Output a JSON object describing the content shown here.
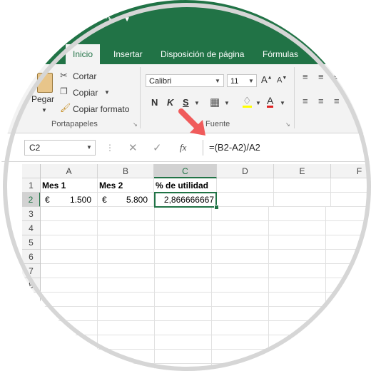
{
  "colors": {
    "accent": "#217346",
    "arrow": "#f05b5b"
  },
  "quick_access": {
    "icons": [
      "save-icon",
      "undo-icon",
      "redo-icon",
      "customize-icon"
    ]
  },
  "tabs": [
    {
      "label": "Inicio",
      "active": true
    },
    {
      "label": "Insertar"
    },
    {
      "label": "Disposición de página"
    },
    {
      "label": "Fórmulas"
    }
  ],
  "clipboard": {
    "paste": "Pegar",
    "cut": "Cortar",
    "copy": "Copiar",
    "format_painter": "Copiar formato",
    "group": "Portapapeles"
  },
  "font": {
    "name": "Calibri",
    "size": "11",
    "bold": "N",
    "italic": "K",
    "underline": "S",
    "group": "Fuente"
  },
  "formula_bar": {
    "name_box": "C2",
    "fx": "fx",
    "formula": "=(B2-A2)/A2"
  },
  "grid": {
    "columns": [
      "A",
      "B",
      "C",
      "D",
      "E",
      "F"
    ],
    "rows": [
      "1",
      "2",
      "3",
      "4",
      "5",
      "6",
      "7",
      "8"
    ],
    "cells": {
      "A1": "Mes 1",
      "B1": "Mes 2",
      "C1": "% de utilidad",
      "A2_symbol": "€",
      "A2": "1.500",
      "B2_symbol": "€",
      "B2": "5.800",
      "C2": "2,866666667"
    }
  }
}
